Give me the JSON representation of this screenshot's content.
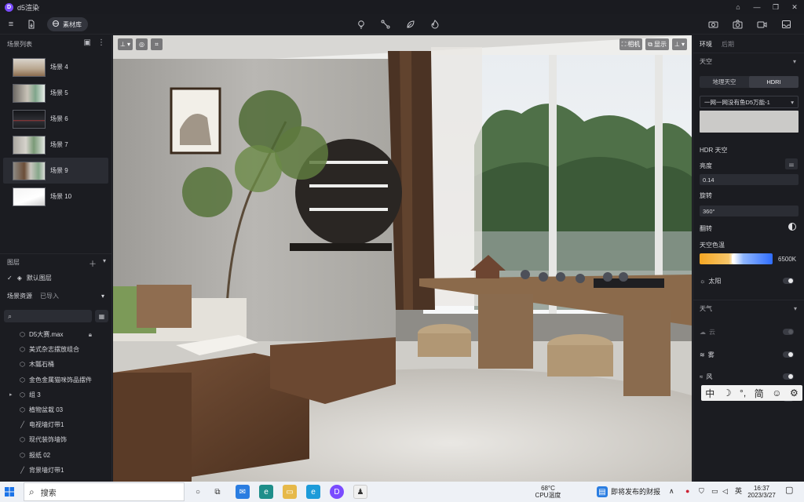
{
  "window": {
    "title": "d5渲染",
    "logo": "D"
  },
  "toolbar": {
    "material_label": "素材库"
  },
  "left": {
    "scene_list_title": "场景列表",
    "scenes": [
      {
        "label": "场景 4"
      },
      {
        "label": "场景 5"
      },
      {
        "label": "场景 6"
      },
      {
        "label": "场景 7"
      },
      {
        "label": "场景 9"
      },
      {
        "label": "场景 10"
      }
    ],
    "layers_title": "图层",
    "default_layer": "默认图层",
    "resources_title": "场景资源",
    "imported_tab": "已导入",
    "search_placeholder": "",
    "tree": [
      {
        "label": "D5大赛.max",
        "icon": "cube",
        "locked": true
      },
      {
        "label": "美式杂志摆放组合",
        "icon": "cube"
      },
      {
        "label": "木瓢石桶",
        "icon": "cube"
      },
      {
        "label": "金色金属猫咪饰品摆件",
        "icon": "cube"
      },
      {
        "label": "组 3",
        "icon": "cube",
        "group": true
      },
      {
        "label": "植物盆栽 03",
        "icon": "cube"
      },
      {
        "label": "电视墙灯带1",
        "icon": "line"
      },
      {
        "label": "现代装饰墙饰",
        "icon": "cube"
      },
      {
        "label": "报纸 02",
        "icon": "cube"
      },
      {
        "label": "背景墙灯带1",
        "icon": "line"
      }
    ]
  },
  "viewport": {
    "camera_label": "相机",
    "display_label": "显示"
  },
  "right": {
    "tab_env": "环境",
    "tab_post": "后期",
    "sky_title": "天空",
    "seg_geo": "地理天空",
    "seg_hdri": "HDRI",
    "hdri_name": "一网一网没有鱼D5万能-1",
    "hdr_sky_label": "HDR 天空",
    "brightness_label": "亮度",
    "brightness_value": "0.14",
    "rotation_label": "旋转",
    "rotation_value": "360°",
    "flip_label": "翻转",
    "color_temp_label": "天空色温",
    "color_temp_value": "6500K",
    "sun_label": "太阳",
    "weather_title": "天气",
    "cloud_label": "云",
    "fog_label": "雾",
    "wind_label": "风"
  },
  "ime": {
    "items": [
      "中",
      "☽",
      "°,",
      "简",
      "☺",
      "⚙"
    ]
  },
  "taskbar": {
    "search_placeholder": "搜索",
    "weather_temp": "68°C",
    "weather_desc": "CPU温度",
    "news": "即将发布的财报",
    "lang": "英",
    "time": "16:37",
    "date": "2023/3/27"
  },
  "colors": {
    "accent": "#7a4bff",
    "panel": "#1b1c21",
    "taskbar": "#eef1f6"
  }
}
